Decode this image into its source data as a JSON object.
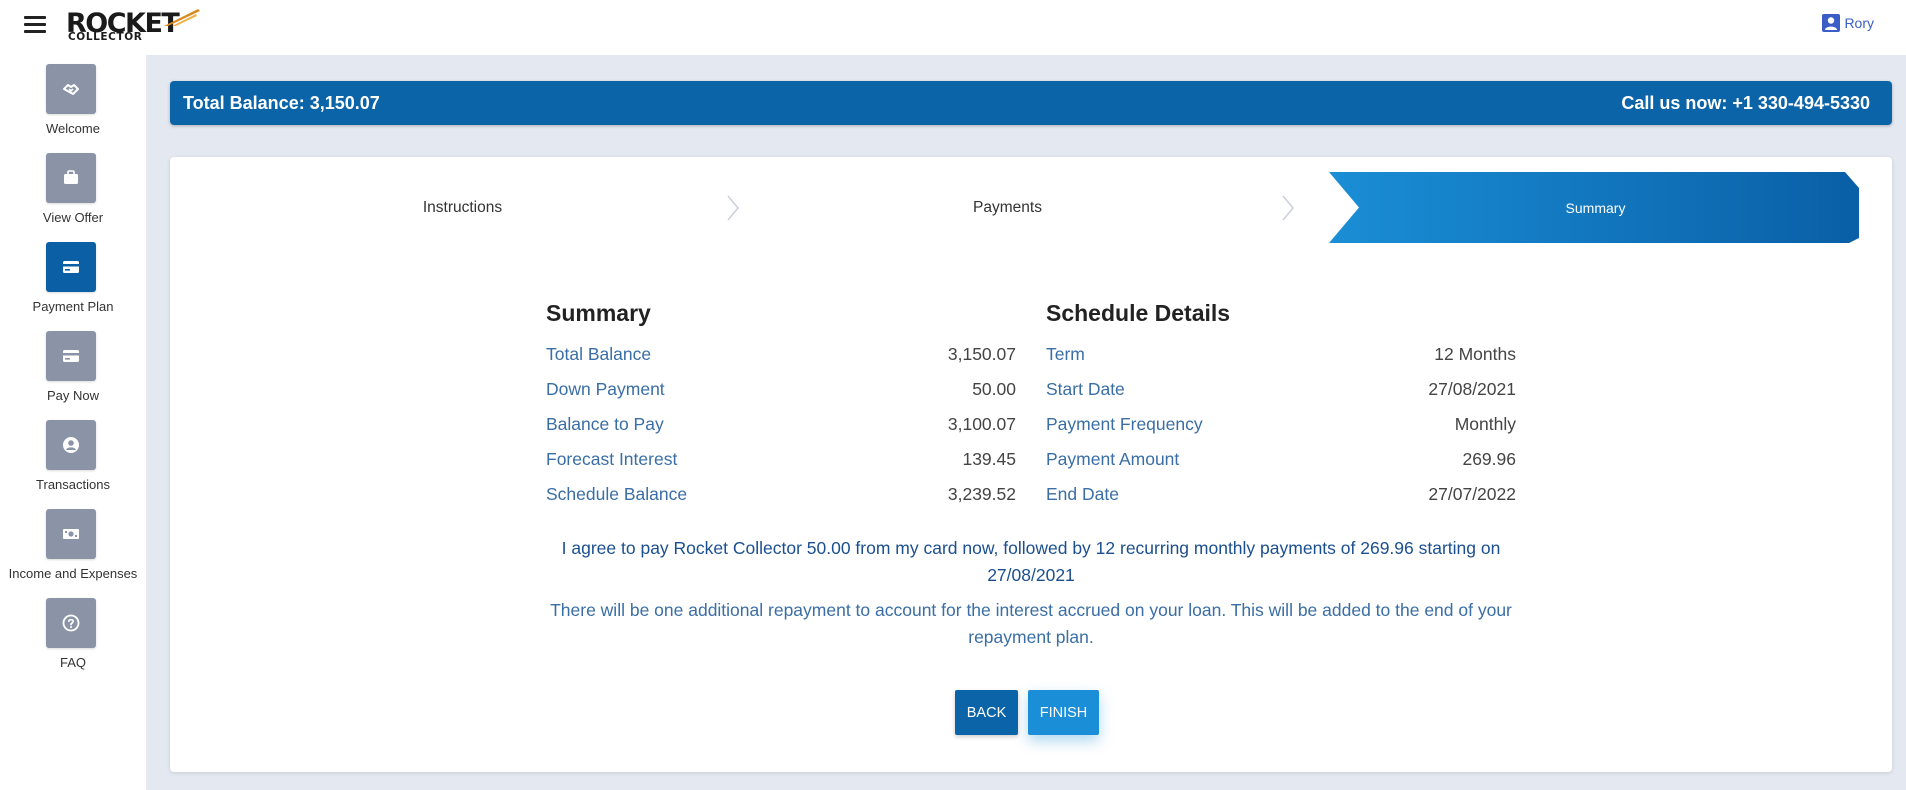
{
  "header": {
    "logo_main": "ROCKET",
    "logo_sub": "COLLECTOR",
    "user_name": "Rory"
  },
  "sidebar": {
    "items": [
      {
        "label": "Welcome",
        "icon": "handshake-icon",
        "active": false
      },
      {
        "label": "View Offer",
        "icon": "briefcase-icon",
        "active": false
      },
      {
        "label": "Payment Plan",
        "icon": "credit-card-icon",
        "active": true
      },
      {
        "label": "Pay Now",
        "icon": "credit-card-icon",
        "active": false
      },
      {
        "label": "Transactions",
        "icon": "user-circle-icon",
        "active": false
      },
      {
        "label": "Income and Expenses",
        "icon": "money-bill-icon",
        "active": false
      },
      {
        "label": "FAQ",
        "icon": "question-circle-icon",
        "active": false
      }
    ]
  },
  "balance_bar": {
    "total_balance": "Total Balance: 3,150.07",
    "call_us": "Call us now: +1 330-494-5330"
  },
  "steps": {
    "items": [
      {
        "label": "Instructions",
        "active": false
      },
      {
        "label": "Payments",
        "active": false
      },
      {
        "label": "Summary",
        "active": true
      }
    ]
  },
  "summary": {
    "title": "Summary",
    "rows": [
      {
        "label": "Total Balance",
        "value": "3,150.07"
      },
      {
        "label": "Down Payment",
        "value": "50.00"
      },
      {
        "label": "Balance to Pay",
        "value": "3,100.07"
      },
      {
        "label": "Forecast Interest",
        "value": "139.45"
      },
      {
        "label": "Schedule Balance",
        "value": "3,239.52"
      }
    ]
  },
  "schedule": {
    "title": "Schedule Details",
    "rows": [
      {
        "label": "Term",
        "value": "12 Months"
      },
      {
        "label": "Start Date",
        "value": "27/08/2021"
      },
      {
        "label": "Payment Frequency",
        "value": "Monthly"
      },
      {
        "label": "Payment Amount",
        "value": "269.96"
      },
      {
        "label": "End Date",
        "value": "27/07/2022"
      }
    ]
  },
  "agreement_text": "I agree to pay Rocket Collector 50.00 from my card now, followed by 12 recurring monthly payments of 269.96 starting on 27/08/2021",
  "note_text": "There will be one additional repayment to account for the interest accrued on your loan. This will be added to the end of your repayment plan.",
  "buttons": {
    "back_label": "BACK",
    "finish_label": "FINISH"
  },
  "colors": {
    "primary": "#0b64a8",
    "accent": "#1a8ed6",
    "sidebar_icon_bg": "#8a94a6",
    "link_text": "#3a6ea5"
  }
}
